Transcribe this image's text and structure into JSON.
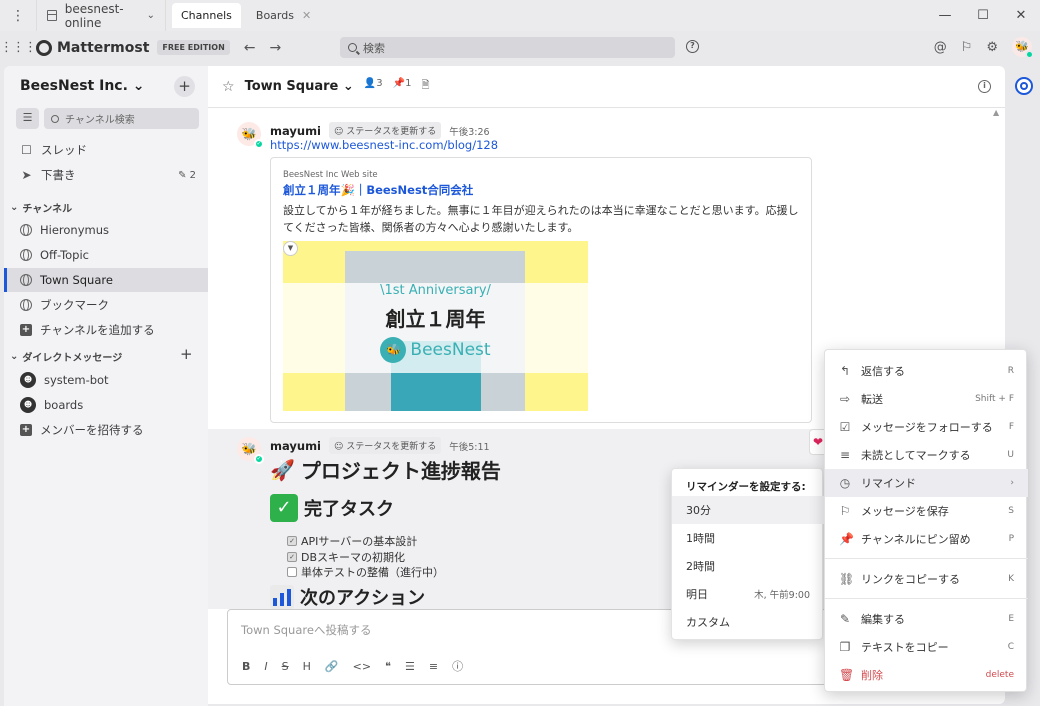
{
  "titlebar": {
    "server_name": "beesnest-online",
    "tabs": [
      {
        "label": "Channels"
      },
      {
        "label": "Boards"
      }
    ],
    "close_tab_glyph": "✕",
    "window_controls": [
      "—",
      "☐",
      "✕"
    ]
  },
  "header": {
    "app_name": "Mattermost",
    "edition": "FREE EDITION",
    "search_placeholder": "検索"
  },
  "sidebar": {
    "team_name": "BeesNest Inc.",
    "channel_search_placeholder": "チャンネル検索",
    "top_items": [
      {
        "label": "スレッド",
        "icon": "threads-icon"
      },
      {
        "label": "下書き",
        "icon": "drafts-icon",
        "count": "2"
      }
    ],
    "channels_header": "チャンネル",
    "channels": [
      {
        "label": "Hieronymus"
      },
      {
        "label": "Off-Topic"
      },
      {
        "label": "Town Square",
        "active": true
      },
      {
        "label": "ブックマーク"
      }
    ],
    "add_channel": "チャンネルを追加する",
    "dm_header": "ダイレクトメッセージ",
    "dms": [
      {
        "label": "system-bot"
      },
      {
        "label": "boards"
      }
    ],
    "invite": "メンバーを招待する"
  },
  "channel": {
    "name": "Town Square",
    "member_count": "3",
    "pinned_count": "1"
  },
  "posts": [
    {
      "user": "mayumi",
      "status": "ステータスを更新する",
      "time": "午後3:26",
      "link": "https://www.beesnest-inc.com/blog/128",
      "preview": {
        "site": "BeesNest Inc Web site",
        "title": "創立１周年🎉｜BeesNest合同会社",
        "description": "設立してから１年が経ちました。無事に１年目が迎えられたのは本当に幸運なことだと思います。応援してくださった皆様、関係者の方々へ心より感謝いたします。",
        "image_anniversary": "\\1st Anniversary/",
        "image_title": "創立１周年",
        "image_brand": "BeesNest"
      }
    },
    {
      "user": "mayumi",
      "status": "ステータスを更新する",
      "time": "午後5:11",
      "h1": "プロジェクト進捗報告",
      "h2_done": "完了タスク",
      "tasks": [
        {
          "label": "APIサーバーの基本設計",
          "checked": true
        },
        {
          "label": "DBスキーマの初期化",
          "checked": true
        },
        {
          "label": "単体テストの整備（進行中）",
          "checked": false
        }
      ],
      "h2_next": "次のアクション"
    }
  ],
  "composer": {
    "placeholder": "Town Squareへ投稿する"
  },
  "reminder_menu": {
    "header": "リマインダーを設定する:",
    "options": [
      {
        "label": "30分"
      },
      {
        "label": "1時間"
      },
      {
        "label": "2時間"
      },
      {
        "label": "明日",
        "sub": "木, 午前9:00"
      },
      {
        "label": "カスタム"
      }
    ]
  },
  "context_menu": {
    "items": [
      {
        "label": "返信する",
        "key": "R"
      },
      {
        "label": "転送",
        "key": "Shift + F"
      },
      {
        "label": "メッセージをフォローする",
        "key": "F"
      },
      {
        "label": "未読としてマークする",
        "key": "U"
      },
      {
        "label": "リマインド",
        "key": "›"
      },
      {
        "label": "メッセージを保存",
        "key": "S"
      },
      {
        "label": "チャンネルにピン留め",
        "key": "P"
      },
      {
        "label": "リンクをコピーする",
        "key": "K"
      },
      {
        "label": "編集する",
        "key": "E"
      },
      {
        "label": "テキストをコピー",
        "key": "C"
      },
      {
        "label": "削除",
        "key": "delete"
      }
    ]
  },
  "colors": {
    "accent": "#1c58d9",
    "online": "#06d6a0",
    "danger": "#d24b4e"
  }
}
